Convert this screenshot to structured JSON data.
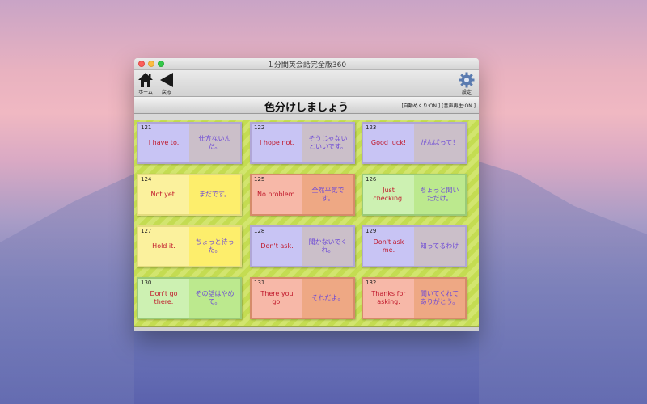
{
  "window": {
    "title": "１分間英会話完全版360"
  },
  "toolbar": {
    "home_label": "ホーム",
    "back_label": "戻る",
    "settings_label": "設定"
  },
  "header": {
    "title": "色分けしましょう",
    "status": "[自動めくり:ON ] [音声再生:ON ]"
  },
  "cards": [
    {
      "num": "121",
      "en": "I have to.",
      "jp": "仕方ないんだ。",
      "color": "purple"
    },
    {
      "num": "122",
      "en": "I hope not.",
      "jp": "そうじゃないといいです。",
      "color": "purple"
    },
    {
      "num": "123",
      "en": "Good luck!",
      "jp": "がんばって！",
      "color": "purple"
    },
    {
      "num": "124",
      "en": "Not yet.",
      "jp": "まだです。",
      "color": "yellow"
    },
    {
      "num": "125",
      "en": "No problem.",
      "jp": "全然平気です。",
      "color": "orange"
    },
    {
      "num": "126",
      "en": "Just checking.",
      "jp": "ちょっと聞いただけ。",
      "color": "green"
    },
    {
      "num": "127",
      "en": "Hold it.",
      "jp": "ちょっと待った。",
      "color": "yellow"
    },
    {
      "num": "128",
      "en": "Don't ask.",
      "jp": "聞かないでくれ。",
      "color": "purple"
    },
    {
      "num": "129",
      "en": "Don't ask me.",
      "jp": "知ってるわけ",
      "color": "purple"
    },
    {
      "num": "130",
      "en": "Don't go there.",
      "jp": "その話はやめて。",
      "color": "green"
    },
    {
      "num": "131",
      "en": "There you go.",
      "jp": "それだよ。",
      "color": "orange"
    },
    {
      "num": "132",
      "en": "Thanks for asking.",
      "jp": "聞いてくれてありがとう。",
      "color": "orange"
    }
  ]
}
